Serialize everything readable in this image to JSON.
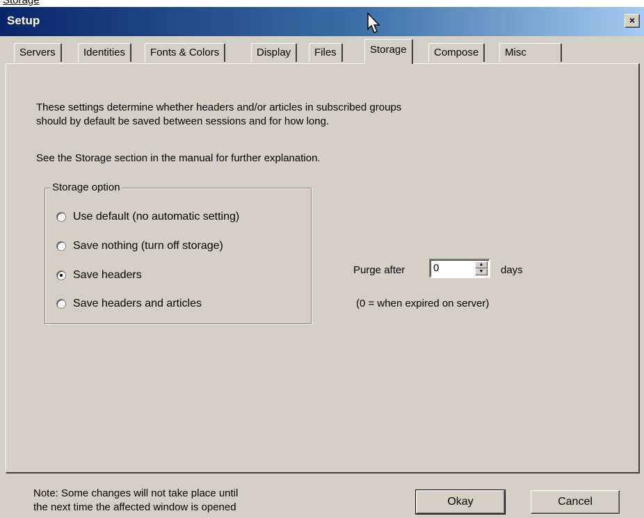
{
  "top_link": "Storage",
  "window": {
    "title": "Setup",
    "close_label": "×"
  },
  "tabs": [
    {
      "label": "Servers"
    },
    {
      "label": "Identities"
    },
    {
      "label": "Fonts & Colors"
    },
    {
      "label": "Display"
    },
    {
      "label": "Files"
    },
    {
      "label": "Storage",
      "active": true
    },
    {
      "label": "Compose"
    },
    {
      "label": "Misc"
    }
  ],
  "description": {
    "line1": "These settings determine whether headers and/or articles in subscribed groups",
    "line2": "should by default be saved between sessions and for how long.",
    "line3": "See the Storage section in the manual for further explanation."
  },
  "storage_option": {
    "group_label": "Storage option",
    "options": [
      {
        "label": "Use default (no automatic setting)",
        "checked": false
      },
      {
        "label": "Save nothing (turn off storage)",
        "checked": false
      },
      {
        "label": "Save headers",
        "checked": true
      },
      {
        "label": "Save headers and articles",
        "checked": false
      }
    ]
  },
  "purge": {
    "label": "Purge after",
    "value": "0",
    "unit": "days",
    "note": "(0 = when expired on server)"
  },
  "footer": {
    "note_line1": "Note: Some changes will not take place until",
    "note_line2": "the next time the affected window is opened",
    "okay_label": "Okay",
    "cancel_label": "Cancel"
  }
}
